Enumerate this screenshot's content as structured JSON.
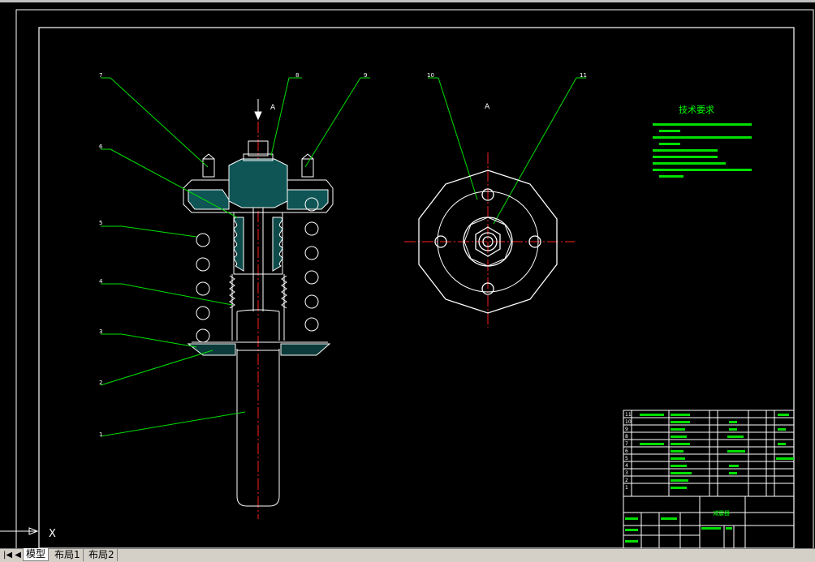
{
  "drawing": {
    "view_label_left": "A",
    "view_label_right": "A",
    "balloons": [
      "1",
      "2",
      "3",
      "4",
      "5",
      "6",
      "7",
      "8",
      "9",
      "10",
      "11"
    ],
    "tech_title": "技术要求"
  },
  "title_block": {
    "part_name": "减震器",
    "rows": [
      "11",
      "10",
      "9",
      "8",
      "7",
      "6",
      "5",
      "4",
      "3",
      "2",
      "1"
    ]
  },
  "ucs": {
    "label": "X"
  },
  "tabs": {
    "nav": "|◀ ◀ ▶ ▶|",
    "model": "模型",
    "layout1": "布局1",
    "layout2": "布局2"
  }
}
